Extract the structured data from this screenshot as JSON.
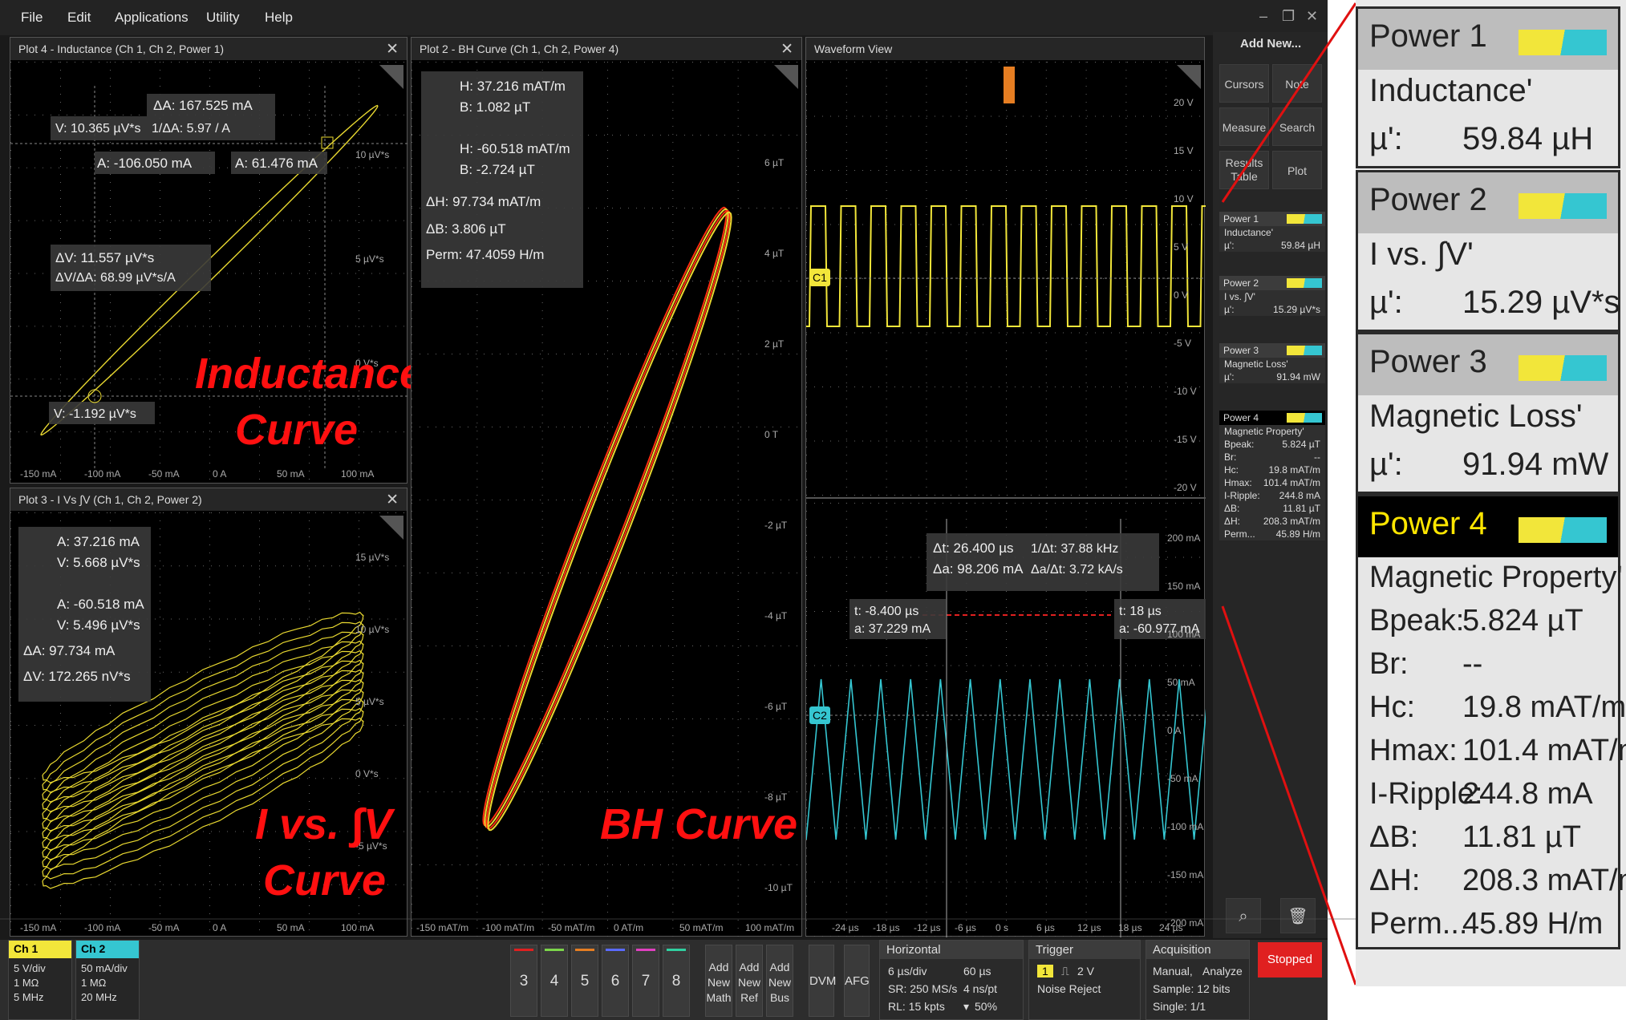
{
  "menu": [
    "File",
    "Edit",
    "Applications",
    "Utility",
    "Help"
  ],
  "plots": {
    "inductance": {
      "title": "Plot 4 - Inductance (Ch 1, Ch 2, Power 1)",
      "label1": "Inductance",
      "label2": "Curve",
      "r1": "ΔA: 167.525 mA",
      "r2": "V: 10.365 µV*s",
      "r3": "1/ΔA:  5.97 / A",
      "r4": "A: -106.050 mA",
      "r5": "A: 61.476 mA",
      "r6": "ΔV: 11.557 µV*s",
      "r7": "ΔV/ΔA:  68.99 µV*s/A",
      "r8": "V: -1.192 µV*s",
      "yticks": [
        "10 µV*s",
        "5 µV*s",
        "0 V*s"
      ],
      "xticks": [
        "-150 mA",
        "-100 mA",
        "-50 mA",
        "0 A",
        "50 mA",
        "100 mA"
      ]
    },
    "ivsv": {
      "title": "Plot 3 - I Vs ∫V (Ch 1, Ch 2, Power 2)",
      "label1": "I vs. ∫V",
      "label2": "Curve",
      "r1": "A: 37.216 mA",
      "r2": "V: 5.668 µV*s",
      "r3": "A: -60.518 mA",
      "r4": "V: 5.496 µV*s",
      "r5": "ΔA: 97.734 mA",
      "r6": "ΔV: 172.265 nV*s",
      "yticks": [
        "15 µV*s",
        "10 µV*s",
        "5 µV*s",
        "0 V*s",
        "-5 µV*s"
      ],
      "xticks": [
        "-150 mA",
        "-100 mA",
        "-50 mA",
        "0 A",
        "50 mA",
        "100 mA"
      ]
    },
    "bh": {
      "title": "Plot 2 - BH Curve (Ch 1, Ch 2, Power 4)",
      "label": "BH Curve",
      "r1": "H: 37.216 mAT/m",
      "r2": "B: 1.082 µT",
      "r3": "H: -60.518 mAT/m",
      "r4": "B: -2.724 µT",
      "r5": "ΔH: 97.734 mAT/m",
      "r6": "ΔB: 3.806 µT",
      "r7": "Perm: 47.4059 H/m",
      "yticks": [
        "6 µT",
        "4 µT",
        "2 µT",
        "0 T",
        "-2 µT",
        "-4 µT",
        "-6 µT",
        "-8 µT",
        "-10 µT"
      ],
      "xticks": [
        "-150 mAT/m",
        "-100 mAT/m",
        "-50 mAT/m",
        "0 AT/m",
        "50 mAT/m",
        "100 mAT/m"
      ]
    },
    "wave": {
      "title": "Waveform View",
      "c1": "C1",
      "c2": "C2",
      "yticks_top": [
        "20 V",
        "15 V",
        "10 V",
        "5 V",
        "0 V",
        "-5 V",
        "-10 V",
        "-15 V",
        "-20 V"
      ],
      "yticks_bot": [
        "200 mA",
        "150 mA",
        "100 mA",
        "50 mA",
        "0 A",
        "-50 mA",
        "-100 mA",
        "-150 mA",
        "-200 mA"
      ],
      "xticks": [
        "-24 µs",
        "-18 µs",
        "-12 µs",
        "-6 µs",
        "0 s",
        "6 µs",
        "12 µs",
        "18 µs",
        "24 µs"
      ],
      "dt": "Δt: 26.400 µs",
      "inv": "1/Δt:  37.88 kHz",
      "da": "Δa: 98.206 mA",
      "dadt": "Δa/Δt:  3.72 kA/s",
      "ta": "t: -8.400 µs",
      "aa": "a: 37.229 mA",
      "tb": "t: 18 µs",
      "ab": "a: -60.977 mA"
    }
  },
  "right": {
    "add_new": "Add New...",
    "buttons": [
      "Cursors",
      "Note",
      "Measure",
      "Search",
      "Results Table",
      "Plot"
    ]
  },
  "badge": {
    "a": "1",
    "b": "2"
  },
  "results": [
    {
      "title": "Power 1",
      "rows": [
        [
          "Inductance'",
          ""
        ],
        [
          "µ':",
          "59.84 µH"
        ]
      ]
    },
    {
      "title": "Power 2",
      "rows": [
        [
          "I vs. ∫V'",
          ""
        ],
        [
          "µ':",
          "15.29 µV*s"
        ]
      ]
    },
    {
      "title": "Power 3",
      "rows": [
        [
          "Magnetic Loss'",
          ""
        ],
        [
          "µ':",
          "91.94 mW"
        ]
      ]
    },
    {
      "title": "Power 4",
      "rows": [
        [
          "Magnetic Property'",
          ""
        ],
        [
          "Bpeak:",
          "5.824 µT"
        ],
        [
          "Br:",
          "--"
        ],
        [
          "Hc:",
          "19.8 mAT/m"
        ],
        [
          "Hmax:",
          "101.4 mAT/m"
        ],
        [
          "I-Ripple:",
          "244.8 mA"
        ],
        [
          "ΔB:",
          "11.81 µT"
        ],
        [
          "ΔH:",
          "208.3 mAT/m"
        ],
        [
          "Perm...",
          "45.89 H/m"
        ]
      ]
    }
  ],
  "bottom": {
    "ch1": {
      "name": "Ch 1",
      "l1": "5 V/div",
      "l2": "1 MΩ",
      "l3": "5 MHz"
    },
    "ch2": {
      "name": "Ch 2",
      "l1": "50 mA/div",
      "l2": "1 MΩ",
      "l3": "20 MHz"
    },
    "nums": [
      "3",
      "4",
      "5",
      "6",
      "7",
      "8"
    ],
    "add": [
      "Add New Math",
      "Add New Ref",
      "Add New Bus"
    ],
    "dvm": "DVM",
    "afg": "AFG",
    "horizontal": {
      "title": "Horizontal",
      "a1": "6 µs/div",
      "a2": "60 µs",
      "b1": "SR: 250 MS/s",
      "b2": "4 ns/pt",
      "c1": "RL: 15 kpts",
      "c2": "50%"
    },
    "trigger": {
      "title": "Trigger",
      "src": "1",
      "lvl": "2 V",
      "mode": "Noise Reject"
    },
    "acq": {
      "title": "Acquisition",
      "a1": "Manual,",
      "a2": "Analyze",
      "b": "Sample: 12 bits",
      "c": "Single: 1/1"
    },
    "stopped": "Stopped"
  },
  "colors": {
    "ch1": "#f2e63a",
    "ch2": "#35c6d1",
    "bh": "#ff2d10",
    "label": "#ff1010",
    "stop": "#e02020"
  }
}
